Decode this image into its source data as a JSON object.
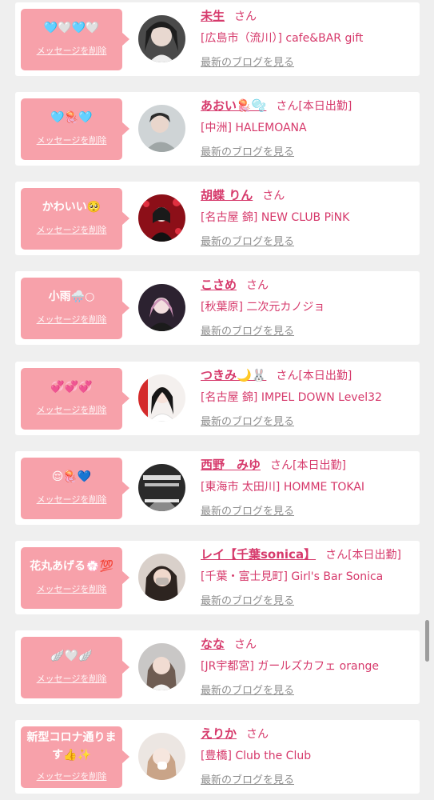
{
  "colors": {
    "accent": "#d6396b",
    "bubble": "#f7a1aa",
    "card": "#ffffff",
    "background": "#efefef",
    "link_gray": "#8e8e8e"
  },
  "delete_label": "メッセージを削除",
  "blog_label": "最新のブログを見る",
  "items": [
    {
      "message": "🩵🤍🩵🤍",
      "name": "未生",
      "suffix": "さん",
      "shop": "[広島市（流川）] cafe&BAR gift",
      "avatar_icon": "person-avatar-icon"
    },
    {
      "message": "🩵🪼🩵",
      "name": "あおい🪼🫧",
      "suffix": "さん[本日出勤]",
      "shop": "[中洲] HALEMOANA",
      "avatar_icon": "person-avatar-icon"
    },
    {
      "message": "かわいい🥺",
      "name": "胡蝶 りん",
      "suffix": "さん",
      "shop": "[名古屋 錦] NEW CLUB PiNK",
      "avatar_icon": "person-avatar-icon"
    },
    {
      "message": "小雨🌧️○",
      "name": "こさめ",
      "suffix": "さん",
      "shop": "[秋葉原] 二次元カノジョ",
      "avatar_icon": "person-avatar-icon"
    },
    {
      "message": "💞💞💞",
      "name": "つきみ🌙🐰",
      "suffix": "さん[本日出勤]",
      "shop": "[名古屋 錦] IMPEL DOWN Level32",
      "avatar_icon": "person-avatar-icon"
    },
    {
      "message": "😌🪼💙",
      "name": "西野　みゆ",
      "suffix": "さん[本日出勤]",
      "shop": "[東海市 太田川] HOMME TOKAI",
      "avatar_icon": "person-avatar-icon"
    },
    {
      "message": "花丸あげる💮💯",
      "name": "レイ【千葉sonica】",
      "suffix": "さん[本日出勤]",
      "shop": "[千葉・富士見町] Girl's Bar Sonica",
      "avatar_icon": "person-avatar-icon"
    },
    {
      "message": "🪽🤍🪽",
      "name": "なな",
      "suffix": "さん",
      "shop": "[JR宇都宮] ガールズカフェ orange",
      "avatar_icon": "person-avatar-icon"
    },
    {
      "message": "新型コロナ通ります👍✨",
      "name": "えりか",
      "suffix": "さん",
      "shop": "[豊橋] Club the Club",
      "avatar_icon": "person-avatar-icon"
    }
  ]
}
